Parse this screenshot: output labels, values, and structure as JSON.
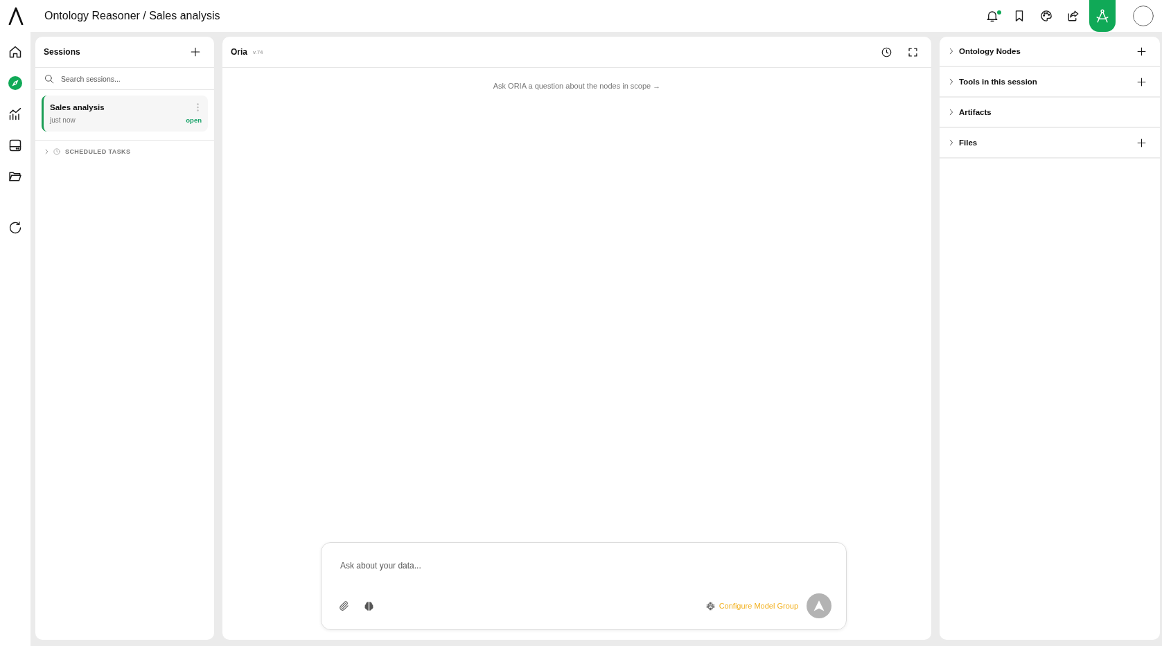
{
  "header": {
    "breadcrumb": "Ontology Reasoner / Sales analysis",
    "notifications_unread": true,
    "mode_toggle": {
      "on": true
    }
  },
  "nav": {
    "items": [
      {
        "selected": false
      },
      {
        "selected": true
      },
      {
        "selected": false
      },
      {
        "selected": false
      },
      {
        "selected": false
      }
    ]
  },
  "sessions": {
    "title": "Sessions",
    "search": {
      "placeholder": "Search sessions..."
    },
    "items": [
      {
        "title": "Sales analysis",
        "time": "just now",
        "status": "open",
        "selected": true
      }
    ],
    "scheduled_tasks": {
      "label": "SCHEDULED TASKS",
      "expanded": false
    }
  },
  "chat": {
    "title": "Oria",
    "version": "v.74",
    "hint": "Ask ORIA a question about the nodes in scope →",
    "composer": {
      "placeholder": "Ask about your data...",
      "model_link": "Configure Model Group",
      "send_disabled": true
    }
  },
  "context": {
    "sections": [
      {
        "label": "Ontology Nodes",
        "expanded": false,
        "addable": true
      },
      {
        "label": "Tools in this session",
        "expanded": false,
        "addable": true
      },
      {
        "label": "Artifacts",
        "expanded": false,
        "addable": false
      },
      {
        "label": "Files",
        "expanded": false,
        "addable": true
      }
    ]
  }
}
